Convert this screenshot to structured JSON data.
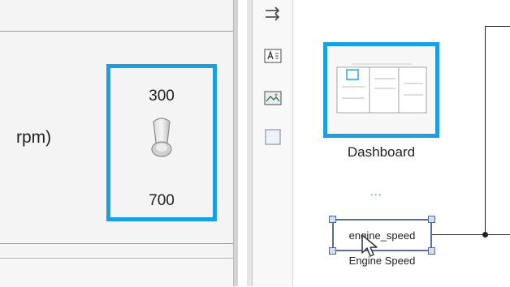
{
  "left_panel": {
    "partial_label": "rpm)",
    "toggle": {
      "top_value": "300",
      "bottom_value": "700",
      "icon": "toggle-switch-icon"
    }
  },
  "toolbar": {
    "tools": [
      {
        "icon": "arrows-right-icon"
      },
      {
        "icon": "text-annotation-icon"
      },
      {
        "icon": "image-annotation-icon"
      },
      {
        "icon": "area-icon"
      }
    ]
  },
  "canvas": {
    "dashboard_block_label": "Dashboard",
    "ellipsis": "...",
    "block_text": "engine_speed",
    "block_caption": "Engine Speed"
  },
  "colors": {
    "selection_blue": "#1aa0e0",
    "handle_blue": "#4a68a6",
    "signal_line": "#222222"
  }
}
